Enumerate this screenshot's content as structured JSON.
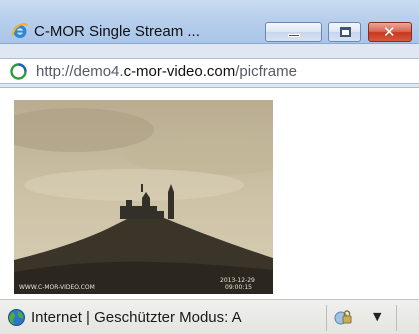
{
  "window": {
    "title": "C-MOR Single Stream ...",
    "title_icon": "ie-logo-icon",
    "controls": {
      "minimize": "minimize-icon",
      "maximize": "maximize-icon",
      "close": "close-icon",
      "close_glyph": "✕"
    }
  },
  "address": {
    "icon": "page-loading-icon",
    "url_prefix": "http://demo4.",
    "url_domain": "c-mor-video.com",
    "url_path": "/picframe"
  },
  "camera": {
    "watermark": "WWW.C-MOR-VIDEO.COM",
    "timestamp_date": "2013-12-29",
    "timestamp_time": "09:00:15"
  },
  "status": {
    "zone_icon": "internet-globe-icon",
    "zone_text": "Internet | Geschützter Modus: A",
    "security_icon": "protected-mode-icon",
    "dropdown_glyph": "▼"
  }
}
